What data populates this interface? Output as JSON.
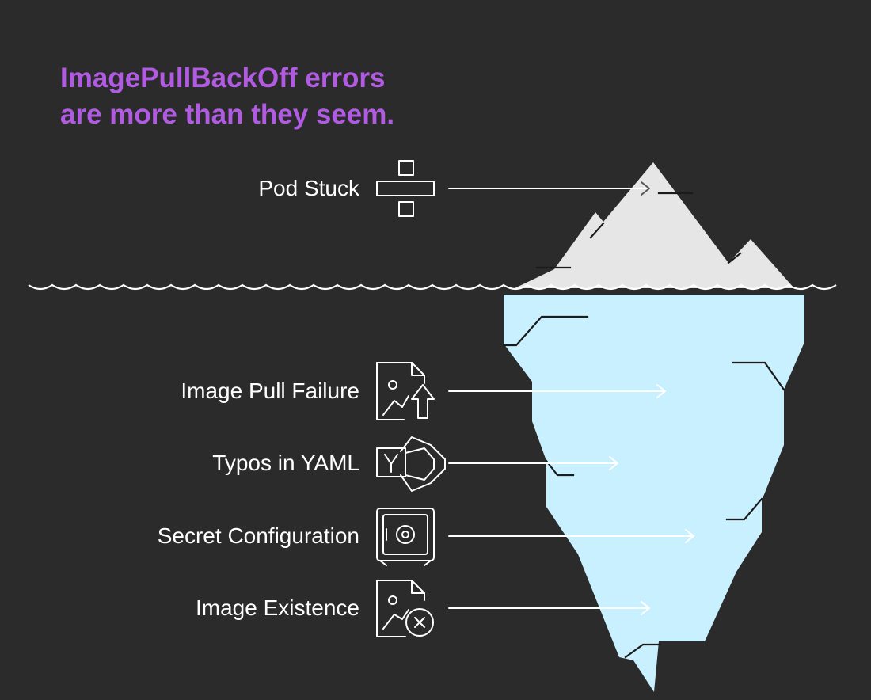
{
  "title": {
    "line1": "ImagePullBackOff errors",
    "line2": "are more than they seem."
  },
  "colors": {
    "background": "#2b2b2b",
    "title": "#b15be3",
    "ice_above": "#e6e6e6",
    "ice_below": "#c8f0ff",
    "line": "#ffffff"
  },
  "items": [
    {
      "label": "Pod Stuck",
      "icon": "divide-icon",
      "zone": "above-water"
    },
    {
      "label": "Image Pull Failure",
      "icon": "image-upload-icon",
      "zone": "below-water"
    },
    {
      "label": "Typos in YAML",
      "icon": "yaml-shield-icon",
      "zone": "below-water"
    },
    {
      "label": "Secret Configuration",
      "icon": "safe-icon",
      "zone": "below-water"
    },
    {
      "label": "Image Existence",
      "icon": "image-error-icon",
      "zone": "below-water"
    }
  ]
}
